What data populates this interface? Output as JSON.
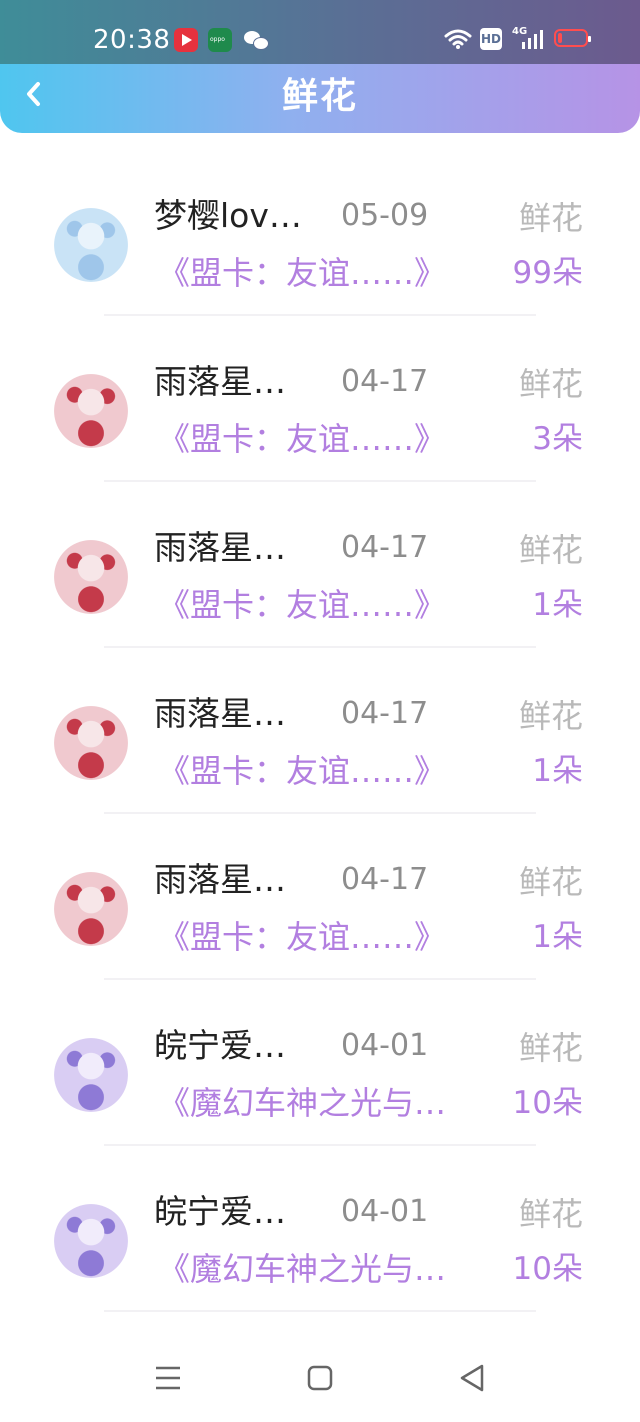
{
  "status_bar": {
    "time": "20:38",
    "hd": "HD",
    "network": "4G",
    "icons": [
      "video-app-icon",
      "oppo-app-icon",
      "wechat-icon",
      "wifi-icon",
      "signal-icon",
      "battery-icon"
    ]
  },
  "header": {
    "title": "鲜花",
    "back_icon": "chevron-left-icon"
  },
  "colors": {
    "gradient_start": "#4fc6ef",
    "gradient_end": "#b693e6",
    "accent_purple": "#b27fe0",
    "muted_gray": "#b9b9b9"
  },
  "list": [
    {
      "name": "梦樱lov…",
      "date": "05-09",
      "type": "鲜花",
      "book": "《盟卡：友谊……》",
      "count": "99朵",
      "avatar_palette": [
        "#c9e3f6",
        "#9fc6ea",
        "#e9f3fb"
      ]
    },
    {
      "name": "雨落星…",
      "date": "04-17",
      "type": "鲜花",
      "book": "《盟卡：友谊……》",
      "count": "3朵",
      "avatar_palette": [
        "#f0c9cf",
        "#c43a4a",
        "#f7e6e8"
      ]
    },
    {
      "name": "雨落星…",
      "date": "04-17",
      "type": "鲜花",
      "book": "《盟卡：友谊……》",
      "count": "1朵",
      "avatar_palette": [
        "#f0c9cf",
        "#c43a4a",
        "#f7e6e8"
      ]
    },
    {
      "name": "雨落星…",
      "date": "04-17",
      "type": "鲜花",
      "book": "《盟卡：友谊……》",
      "count": "1朵",
      "avatar_palette": [
        "#f0c9cf",
        "#c43a4a",
        "#f7e6e8"
      ]
    },
    {
      "name": "雨落星…",
      "date": "04-17",
      "type": "鲜花",
      "book": "《盟卡：友谊……》",
      "count": "1朵",
      "avatar_palette": [
        "#f0c9cf",
        "#c43a4a",
        "#f7e6e8"
      ]
    },
    {
      "name": "皖宁爱…",
      "date": "04-01",
      "type": "鲜花",
      "book": "《魔幻车神之光与…",
      "count": "10朵",
      "avatar_palette": [
        "#d9cdf3",
        "#8e7ad6",
        "#f1ecfb"
      ]
    },
    {
      "name": "皖宁爱…",
      "date": "04-01",
      "type": "鲜花",
      "book": "《魔幻车神之光与…",
      "count": "10朵",
      "avatar_palette": [
        "#d9cdf3",
        "#8e7ad6",
        "#f1ecfb"
      ]
    }
  ],
  "nav_bar": {
    "icons": [
      "menu-icon",
      "home-square-icon",
      "back-triangle-icon"
    ]
  }
}
